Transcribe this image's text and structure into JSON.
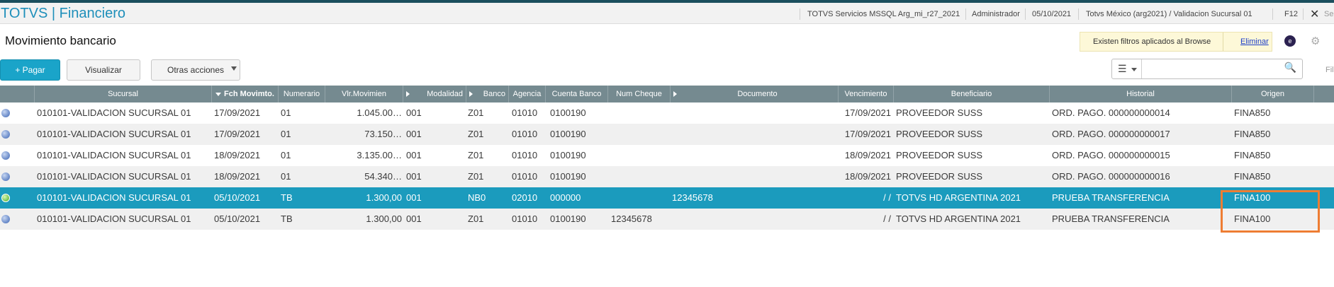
{
  "titlebar": {
    "app_title": "TOTVS | Financiero",
    "environment": "TOTVS Servicios MSSQL Arg_mi_r27_2021",
    "user": "Administrador",
    "date": "05/10/2021",
    "company": "Totvs México (arg2021) / Validacion Sucursal 01",
    "f12": "F12",
    "close": "✕",
    "search_stub": "Se"
  },
  "page": {
    "title": "Movimiento bancario"
  },
  "filter_notice": {
    "text": "Existen filtros aplicados al Browse",
    "link": "Eliminar"
  },
  "toolbar": {
    "pagar": "Pagar",
    "visualizar": "Visualizar",
    "otras": "Otras acciones",
    "filter_stub": "Fil"
  },
  "grid": {
    "columns": [
      "Sucursal",
      "Fch Movimto.",
      "Numerario",
      "Vlr.Movimien",
      "Modalidad",
      "Banco",
      "Agencia",
      "Cuenta Banco",
      "Num Cheque",
      "Documento",
      "Vencimiento",
      "Beneficiario",
      "Historial",
      "Origen"
    ],
    "rows": [
      {
        "status": "blue",
        "sucursal": "010101-VALIDACION SUCURSAL 01",
        "fecha": "17/09/2021",
        "numerario": "01",
        "valor": "1.045.00…",
        "modalidad": "001",
        "banco": "Z01",
        "agencia": "01010",
        "cuenta": "0100190",
        "cheque": "",
        "documento": "",
        "vencimiento": "17/09/2021",
        "beneficiario": "PROVEEDOR SUSS",
        "historial": "ORD. PAGO.  000000000014",
        "origen": "FINA850"
      },
      {
        "status": "blue",
        "sucursal": "010101-VALIDACION SUCURSAL 01",
        "fecha": "17/09/2021",
        "numerario": "01",
        "valor": "73.150…",
        "modalidad": "001",
        "banco": "Z01",
        "agencia": "01010",
        "cuenta": "0100190",
        "cheque": "",
        "documento": "",
        "vencimiento": "17/09/2021",
        "beneficiario": "PROVEEDOR SUSS",
        "historial": "ORD. PAGO.  000000000017",
        "origen": "FINA850"
      },
      {
        "status": "blue",
        "sucursal": "010101-VALIDACION SUCURSAL 01",
        "fecha": "18/09/2021",
        "numerario": "01",
        "valor": "3.135.00…",
        "modalidad": "001",
        "banco": "Z01",
        "agencia": "01010",
        "cuenta": "0100190",
        "cheque": "",
        "documento": "",
        "vencimiento": "18/09/2021",
        "beneficiario": "PROVEEDOR SUSS",
        "historial": "ORD. PAGO.  000000000015",
        "origen": "FINA850"
      },
      {
        "status": "blue",
        "sucursal": "010101-VALIDACION SUCURSAL 01",
        "fecha": "18/09/2021",
        "numerario": "01",
        "valor": "54.340…",
        "modalidad": "001",
        "banco": "Z01",
        "agencia": "01010",
        "cuenta": "0100190",
        "cheque": "",
        "documento": "",
        "vencimiento": "18/09/2021",
        "beneficiario": "PROVEEDOR SUSS",
        "historial": "ORD. PAGO.  000000000016",
        "origen": "FINA850"
      },
      {
        "status": "green",
        "sucursal": "010101-VALIDACION SUCURSAL 01",
        "fecha": "05/10/2021",
        "numerario": "TB",
        "valor": "1.300,00",
        "modalidad": "001",
        "banco": "NB0",
        "agencia": "02010",
        "cuenta": "000000",
        "cheque": "",
        "documento": "12345678",
        "vencimiento": "/  /",
        "beneficiario": "TOTVS HD ARGENTINA 2021",
        "historial": "PRUEBA TRANSFERENCIA",
        "origen": "FINA100"
      },
      {
        "status": "blue",
        "sucursal": "010101-VALIDACION SUCURSAL 01",
        "fecha": "05/10/2021",
        "numerario": "TB",
        "valor": "1.300,00",
        "modalidad": "001",
        "banco": "Z01",
        "agencia": "01010",
        "cuenta": "0100190",
        "cheque": "12345678",
        "documento": "",
        "vencimiento": "/  /",
        "beneficiario": "TOTVS HD ARGENTINA 2021",
        "historial": "PRUEBA TRANSFERENCIA",
        "origen": "FINA100"
      }
    ],
    "selected_row": 4
  },
  "colors": {
    "accent": "#1aa4c9",
    "header_bg": "#758a90",
    "highlight_box": "#ee7d33",
    "selected_row": "#1b9bbd"
  }
}
